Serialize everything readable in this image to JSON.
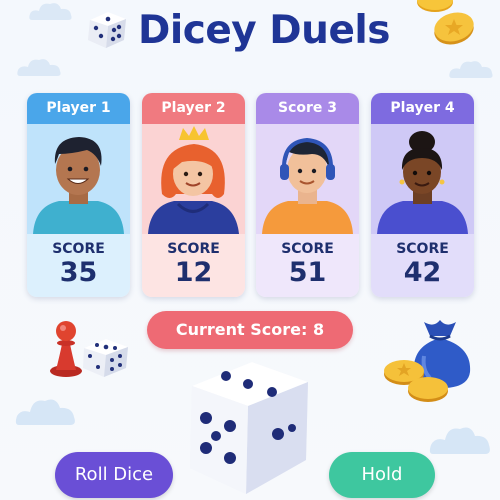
{
  "title": "Dicey Duels",
  "players": [
    {
      "name": "Player 1",
      "score_label": "SCORE",
      "score": "35",
      "header_color": "#4aa6ea",
      "bg_color": "#bfe3fb",
      "score_bg": "#dcf0fd"
    },
    {
      "name": "Player 2",
      "score_label": "SCORE",
      "score": "12",
      "header_color": "#f07a80",
      "bg_color": "#fbd3d3",
      "score_bg": "#fde4e3"
    },
    {
      "name": "Score 3",
      "score_label": "SCORE",
      "score": "51",
      "header_color": "#a98ae8",
      "bg_color": "#e3d7f8",
      "score_bg": "#efe7fb"
    },
    {
      "name": "Player 4",
      "score_label": "SCORE",
      "score": "42",
      "header_color": "#7e6be0",
      "bg_color": "#cfc9f6",
      "score_bg": "#e2ddfa"
    }
  ],
  "current_score_text": "Current Score: 8",
  "buttons": {
    "roll": "Roll Dice",
    "hold": "Hold"
  },
  "icons": [
    "dice-icon",
    "crown-icon",
    "pawn-icon",
    "coin-icon",
    "money-bag-icon",
    "cloud-icon"
  ]
}
